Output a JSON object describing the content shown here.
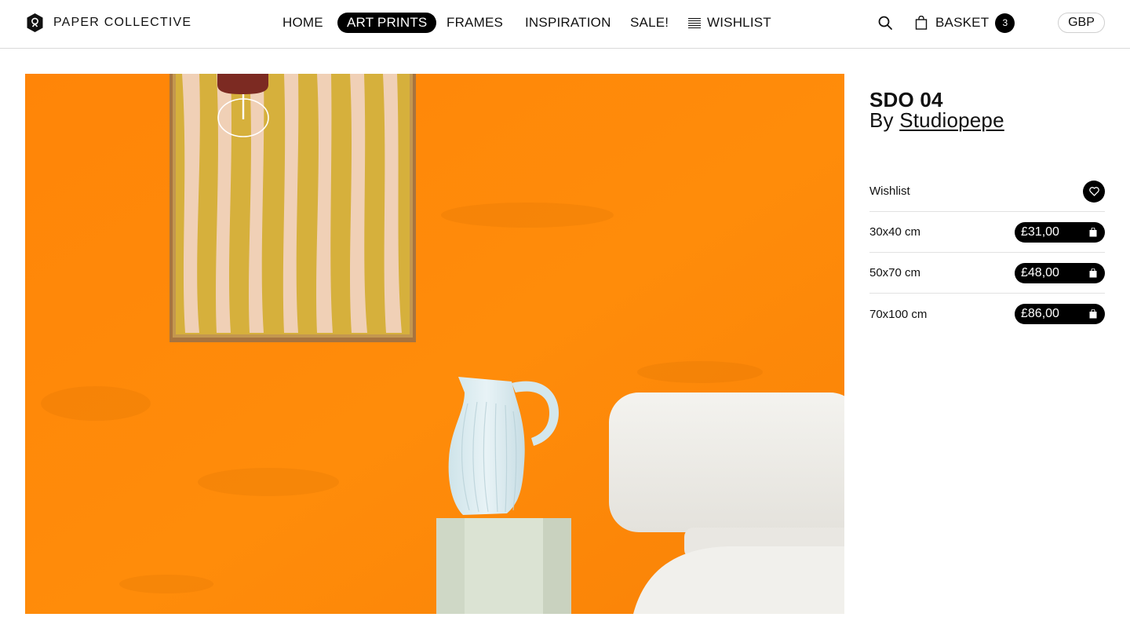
{
  "brand": {
    "name": "PAPER COLLECTIVE"
  },
  "nav": {
    "items": [
      {
        "label": "HOME"
      },
      {
        "label": "ART PRINTS"
      },
      {
        "label": "FRAMES"
      },
      {
        "label": "INSPIRATION"
      },
      {
        "label": "SALE!"
      },
      {
        "label": "WISHLIST"
      }
    ],
    "active": "ART PRINTS"
  },
  "header": {
    "search_icon": "search-icon",
    "basket_label": "BASKET",
    "basket_count": "3",
    "currency": "GBP"
  },
  "product": {
    "title": "SDO 04",
    "by_prefix": "By",
    "artist": "Studiopepe",
    "wishlist_label": "Wishlist",
    "sizes": [
      {
        "label": "30x40 cm",
        "price": "£31,00"
      },
      {
        "label": "50x70 cm",
        "price": "£48,00"
      },
      {
        "label": "70x100 cm",
        "price": "£86,00"
      }
    ]
  },
  "colors": {
    "wall_orange": "#ff8a08",
    "accent": "#000000"
  }
}
